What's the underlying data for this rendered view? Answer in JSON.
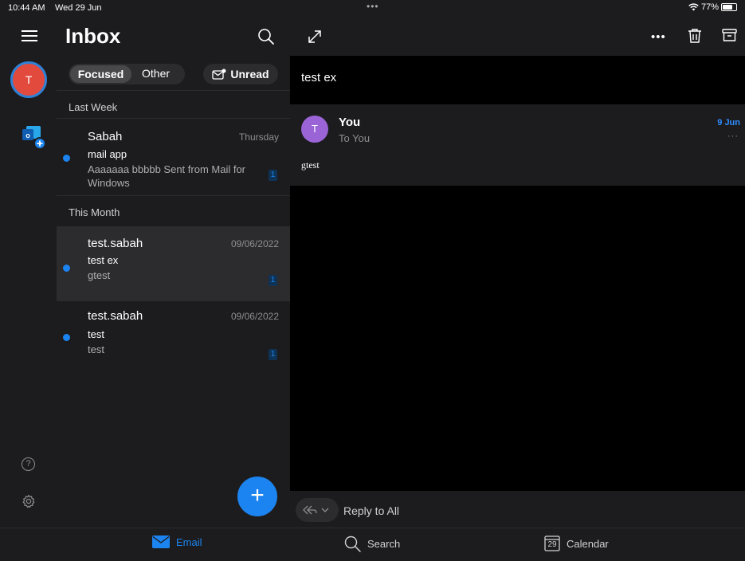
{
  "status": {
    "time": "10:44 AM",
    "date": "Wed 29 Jun",
    "dots": "•••",
    "battery": "77%"
  },
  "rail": {
    "account_initial": "T",
    "help_glyph": "?"
  },
  "list": {
    "title": "Inbox",
    "tabs": {
      "focused": "Focused",
      "other": "Other"
    },
    "unread_label": "Unread",
    "sections": [
      {
        "header": "Last Week"
      },
      {
        "header": "This Month"
      }
    ],
    "items": [
      {
        "from": "Sabah",
        "when": "Thursday",
        "subject": "mail app",
        "preview": "Aaaaaaa bbbbb Sent from Mail for Windows",
        "count": "1"
      },
      {
        "from": "test.sabah",
        "when": "09/06/2022",
        "subject": "test ex",
        "preview": "gtest",
        "count": "1"
      },
      {
        "from": "test.sabah",
        "when": "09/06/2022",
        "subject": "test",
        "preview": "test",
        "count": "1"
      }
    ],
    "fab_glyph": "+"
  },
  "reading": {
    "subject": "test ex",
    "more_glyph": "•••",
    "message": {
      "avatar_initial": "T",
      "from": "You",
      "to": "To You",
      "date": "9 Jun",
      "more": "···",
      "body": "gtest"
    },
    "reply_label": "Reply to All"
  },
  "tabbar": {
    "email": "Email",
    "search": "Search",
    "calendar": "Calendar",
    "calendar_day": "29"
  },
  "colors": {
    "accent": "#1c84f0",
    "avatar_red": "#e34a3e",
    "avatar_purple": "#9a64d6",
    "panel": "#1c1c1e"
  },
  "icons": [
    "hamburger-icon",
    "search-icon",
    "expand-icon",
    "more-icon",
    "trash-icon",
    "archive-icon",
    "reply-all-icon",
    "chevron-down-icon",
    "mail-icon",
    "calendar-icon",
    "help-icon",
    "gear-icon",
    "outlook-add-icon",
    "wifi-icon",
    "battery-icon",
    "envelope-unread-icon"
  ]
}
